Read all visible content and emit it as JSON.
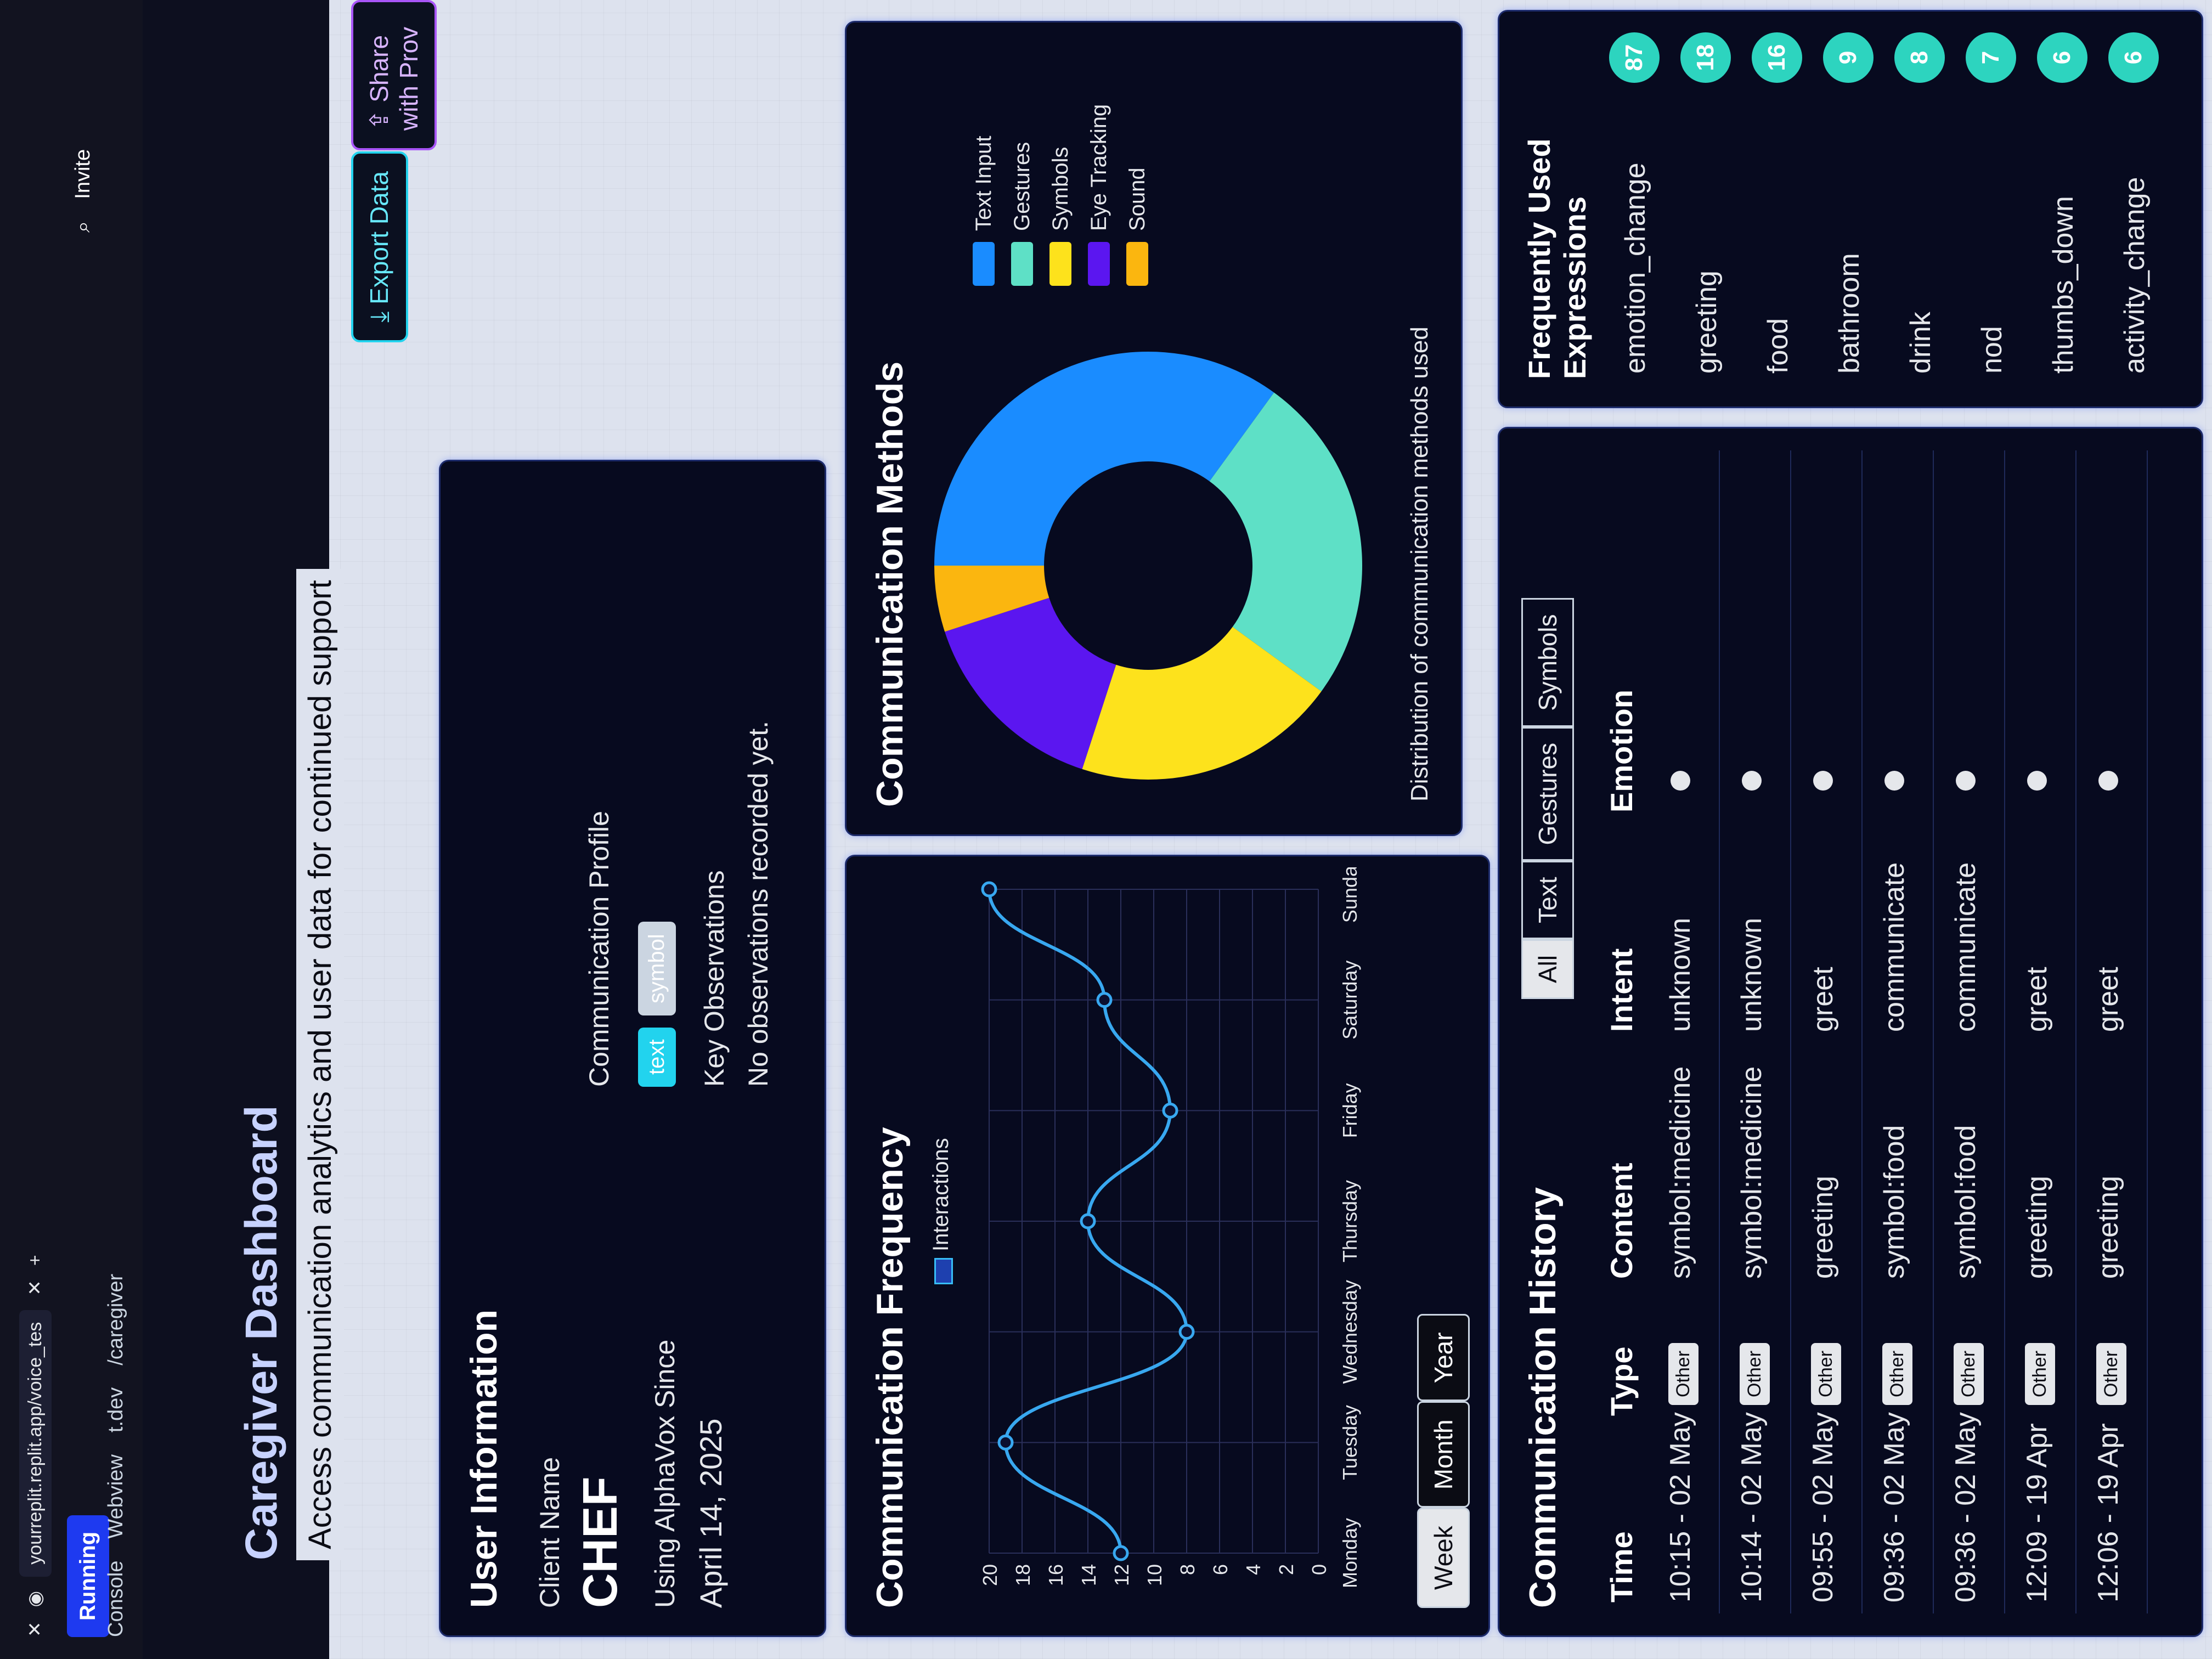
{
  "browser": {
    "url": "yourreplit.replit.app/voice_tes",
    "new_tab": "+"
  },
  "workspace": {
    "status": "Running",
    "tabs": [
      "Console",
      "Webview"
    ],
    "path": "/caregiver",
    "domain": "t.dev",
    "invite": "Invite"
  },
  "header": {
    "title": "Caregiver Dashboard",
    "subtitle": "Access communication analytics and user data for continued support",
    "export_label": "Export Data",
    "share_label": "Share with Prov"
  },
  "user_info": {
    "title": "User Information",
    "client_label": "Client Name",
    "client_name": "CHEF",
    "since_label": "Using AlphaVox Since",
    "since_date": "April 14, 2025",
    "profile_label": "Communication Profile",
    "profile_tags": [
      "text",
      "symbol"
    ],
    "obs_label": "Key Observations",
    "obs_text": "No observations recorded yet."
  },
  "frequency": {
    "title": "Communication Frequency",
    "periods": [
      "Week",
      "Month",
      "Year"
    ],
    "selected_period": "Week"
  },
  "methods": {
    "title": "Communication Methods",
    "caption": "Distribution of communication methods used"
  },
  "history": {
    "title": "Communication History",
    "filters": [
      "All",
      "Text",
      "Gestures",
      "Symbols"
    ],
    "selected_filter": "All",
    "columns": [
      "Time",
      "Type",
      "Content",
      "Intent",
      "Emotion"
    ],
    "rows": [
      {
        "time": "10:15 - 02 May",
        "type": "Other",
        "content": "symbol:medicine",
        "intent": "unknown"
      },
      {
        "time": "10:14 - 02 May",
        "type": "Other",
        "content": "symbol:medicine",
        "intent": "unknown"
      },
      {
        "time": "09:55 - 02 May",
        "type": "Other",
        "content": "greeting",
        "intent": "greet"
      },
      {
        "time": "09:36 - 02 May",
        "type": "Other",
        "content": "symbol:food",
        "intent": "communicate"
      },
      {
        "time": "09:36 - 02 May",
        "type": "Other",
        "content": "symbol:food",
        "intent": "communicate"
      },
      {
        "time": "12:09 - 19 Apr",
        "type": "Other",
        "content": "greeting",
        "intent": "greet"
      },
      {
        "time": "12:06 - 19 Apr",
        "type": "Other",
        "content": "greeting",
        "intent": "greet"
      }
    ]
  },
  "expressions": {
    "title": "Frequently Used Expressions",
    "items": [
      {
        "label": "emotion_change",
        "count": "87"
      },
      {
        "label": "greeting",
        "count": "18"
      },
      {
        "label": "food",
        "count": "16"
      },
      {
        "label": "bathroom",
        "count": "9"
      },
      {
        "label": "drink",
        "count": "8"
      },
      {
        "label": "nod",
        "count": "7"
      },
      {
        "label": "thumbs_down",
        "count": "6"
      },
      {
        "label": "activity_change",
        "count": "6"
      }
    ]
  },
  "colors": {
    "text_input": "#1a8cff",
    "gestures": "#5ee0c6",
    "symbols": "#fde21c",
    "eye_tracking": "#5b16f0",
    "sound": "#fbb60f",
    "line": "#38a8f0"
  },
  "chart_data": [
    {
      "type": "line",
      "title": "",
      "series": [
        {
          "name": "Interactions",
          "values": [
            12,
            19,
            8,
            14,
            9,
            13,
            20
          ]
        }
      ],
      "categories": [
        "Monday",
        "Tuesday",
        "Wednesday",
        "Thursday",
        "Friday",
        "Saturday",
        "Sunday"
      ],
      "ylim": [
        0,
        20
      ],
      "yticks": [
        "0",
        "2",
        "4",
        "6",
        "8",
        "10",
        "12",
        "14",
        "16",
        "18",
        "20"
      ],
      "legend_position": "top",
      "grid": true
    },
    {
      "type": "pie",
      "title": "",
      "labels": [
        "Text Input",
        "Gestures",
        "Symbols",
        "Eye Tracking",
        "Sound"
      ],
      "values": [
        35,
        25,
        20,
        15,
        5
      ],
      "legend_position": "right"
    }
  ]
}
